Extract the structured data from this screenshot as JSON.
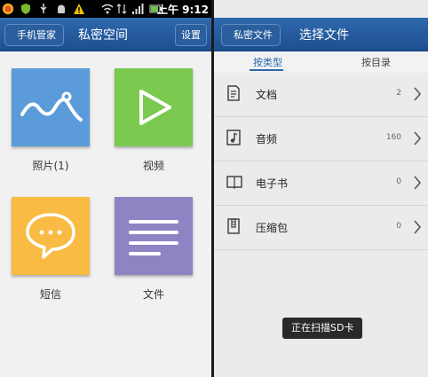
{
  "status_bar": {
    "time": "上午 9:12"
  },
  "left_screen": {
    "back_label": "手机管家",
    "title": "私密空间",
    "settings_label": "设置",
    "tiles": [
      {
        "label": "照片(1)",
        "icon": "photo-icon",
        "color": "#5b9bd9"
      },
      {
        "label": "视频",
        "icon": "video-play-icon",
        "color": "#7cc94f"
      },
      {
        "label": "短信",
        "icon": "sms-icon",
        "color": "#f9bb44"
      },
      {
        "label": "文件",
        "icon": "file-lines-icon",
        "color": "#8e84c4"
      }
    ]
  },
  "right_screen": {
    "back_label": "私密文件",
    "title": "选择文件",
    "tabs": [
      {
        "label": "按类型",
        "active": true
      },
      {
        "label": "按目录",
        "active": false
      }
    ],
    "rows": [
      {
        "label": "文档",
        "count": "2",
        "icon": "document-icon"
      },
      {
        "label": "音频",
        "count": "160",
        "icon": "music-note-icon"
      },
      {
        "label": "电子书",
        "count": "0",
        "icon": "book-icon"
      },
      {
        "label": "压缩包",
        "count": "0",
        "icon": "archive-icon"
      }
    ],
    "toast": "正在扫描SD卡"
  }
}
